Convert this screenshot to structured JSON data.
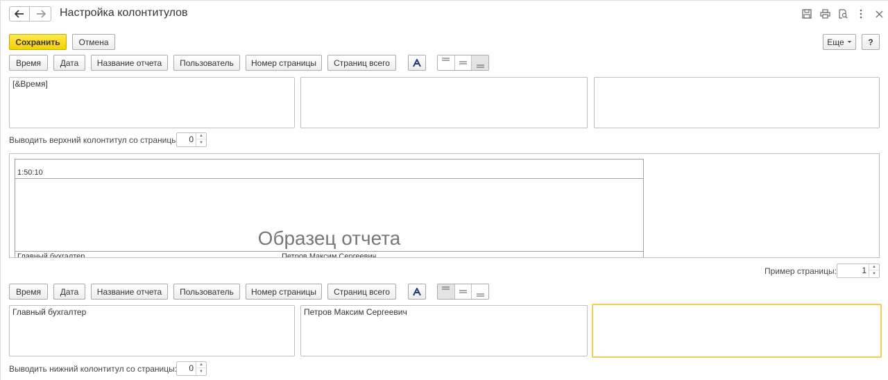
{
  "window": {
    "title": "Настройка колонтитулов",
    "icons": [
      "back-arrow-icon",
      "forward-arrow-icon",
      "save-disk-icon",
      "print-icon",
      "preview-icon",
      "more-vertical-icon",
      "close-icon"
    ]
  },
  "toolbar": {
    "save_label": "Сохранить",
    "cancel_label": "Отмена",
    "more_label": "Еще",
    "help_label": "?"
  },
  "insert_buttons": {
    "time": "Время",
    "date": "Дата",
    "report_name": "Название отчета",
    "user": "Пользователь",
    "page_number": "Номер страницы",
    "pages_total": "Страниц всего"
  },
  "header": {
    "left": "[&Время]",
    "center": "",
    "right": "",
    "alignment_active": "bottom",
    "start_page_label": "Выводить верхний колонтитул со страницы:",
    "start_page_value": "0"
  },
  "preview": {
    "header_text": "1:50:10",
    "sample_title": "Образец отчета",
    "footer_left": "Главный бухгалтер",
    "footer_center": "Петров Максим Сергеевич",
    "page_example_label": "Пример страницы:",
    "page_example_value": "1"
  },
  "footer": {
    "left": "Главный бухгалтер",
    "center": "Петров Максим Сергеевич",
    "right": "",
    "alignment_active": "top",
    "start_page_label": "Выводить нижний колонтитул со страницы:",
    "start_page_value": "0"
  },
  "colors": {
    "save_button": "#f5d000",
    "focus_border": "#f0cf4b",
    "font_icon": "#1f3f78"
  }
}
